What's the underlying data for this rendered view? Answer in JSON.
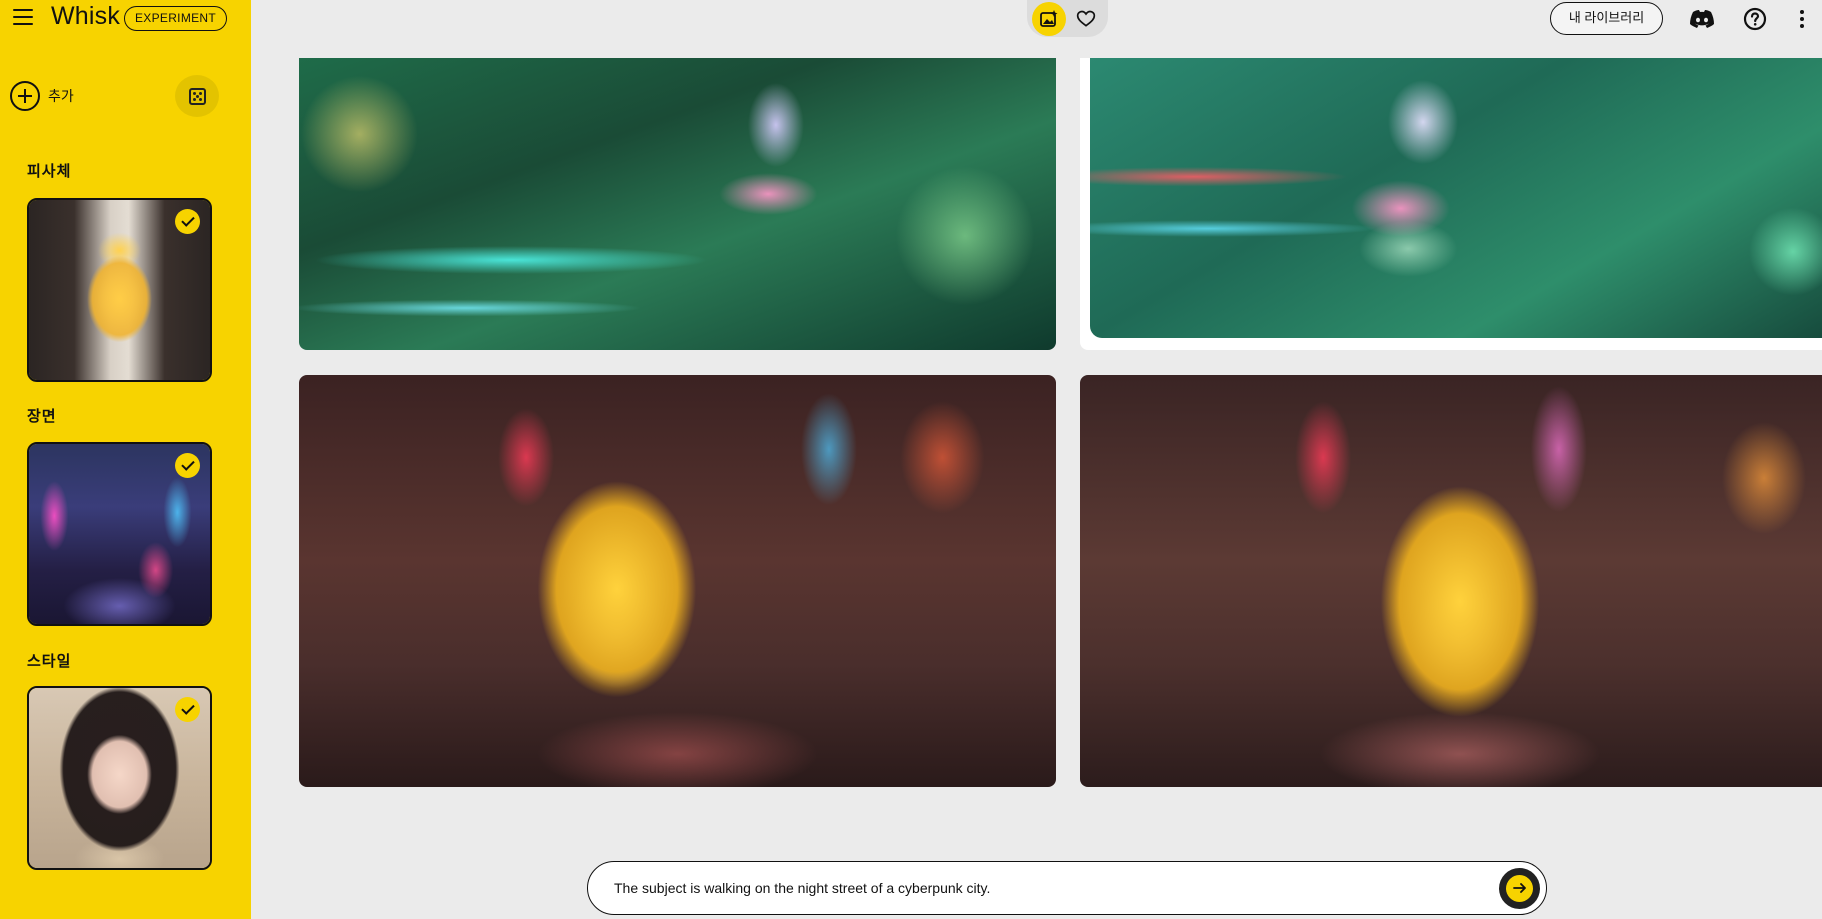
{
  "app": {
    "title": "Whisk",
    "badge": "EXPERIMENT",
    "accent_color": "#f7d300"
  },
  "sidebar": {
    "add_label": "추가",
    "random_icon": "dice-icon",
    "sections": [
      {
        "label": "피사체",
        "image": "duck-on-runway",
        "selected": true
      },
      {
        "label": "장면",
        "image": "neon-city-street",
        "selected": true
      },
      {
        "label": "스타일",
        "image": "illustrated-portrait",
        "selected": true
      }
    ]
  },
  "topbar": {
    "toggle_items": [
      {
        "icon": "image-sparkle-icon",
        "active": true
      },
      {
        "icon": "heart-icon",
        "active": false
      }
    ],
    "library_label": "내 라이브러리",
    "icons": [
      "discord-icon",
      "help-icon",
      "more-vert-icon"
    ]
  },
  "gallery": {
    "images": [
      {
        "description": "jungle-rider-red-bike"
      },
      {
        "description": "jungle-rider-green-bike"
      },
      {
        "description": "duck-cyberpunk-street-1"
      },
      {
        "description": "duck-cyberpunk-street-2"
      }
    ]
  },
  "prompt": {
    "value": "The subject is walking on the night street of a cyberpunk city.",
    "send_icon": "arrow-right-icon"
  }
}
